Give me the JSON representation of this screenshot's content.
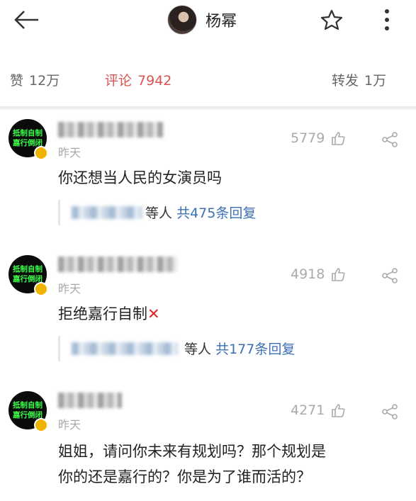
{
  "header": {
    "title": "杨幂"
  },
  "tabs": {
    "likes_label": "赞",
    "likes_count": "12万",
    "comments_label": "评论",
    "comments_count": "7942",
    "reposts_label": "转发",
    "reposts_count": "1万"
  },
  "comments": [
    {
      "avatar_text_line1": "抵制自制",
      "avatar_text_line2": "嘉行倒闭",
      "time": "昨天",
      "likes": "5779",
      "text_line1": "你还想当人民的女演员吗",
      "text_line2": "",
      "replies_suffix": "等人",
      "replies_link": "共475条回复"
    },
    {
      "avatar_text_line1": "抵制自制",
      "avatar_text_line2": "嘉行倒闭",
      "time": "昨天",
      "likes": "4918",
      "text_line1": "拒绝嘉行自制",
      "text_line2": "",
      "replies_suffix": "等人",
      "replies_link": "共177条回复"
    },
    {
      "avatar_text_line1": "抵制自制",
      "avatar_text_line2": "嘉行倒闭",
      "time": "昨天",
      "likes": "4271",
      "text_line1": "姐姐，请问你未来有规划吗？那个规划是",
      "text_line2": "你的还是嘉行的？你是为了谁而活的？"
    }
  ],
  "icons": {
    "back": "back-arrow-icon",
    "avatar": "avatar",
    "star": "star-icon",
    "more": "more-vertical-icon",
    "like": "thumbs-up-icon",
    "share": "share-icon",
    "cross": "red-x-icon"
  },
  "colors": {
    "accent_red": "#d9534f",
    "link_blue": "#3b6fb6",
    "avatar_green": "#3aff48",
    "muted_gray": "#aaaaaa"
  }
}
